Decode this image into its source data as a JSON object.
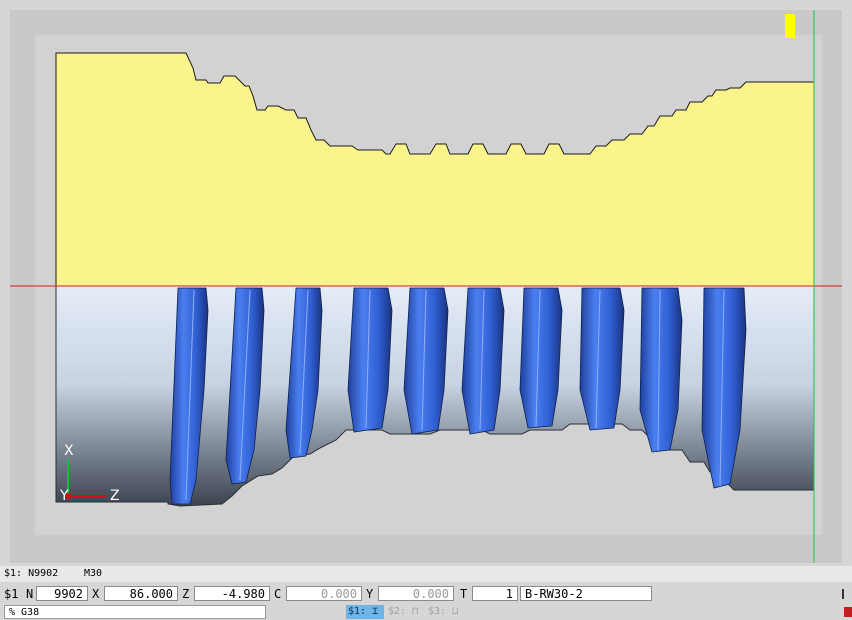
{
  "simulation": {
    "axes": {
      "x_label": "X",
      "y_label": "Y",
      "z_label": "Z"
    },
    "colors": {
      "stock": "#fbf48c",
      "part_top": "#e8eef6",
      "part_bottom": "#3a424e",
      "groove": "#3e6fe0",
      "background": "#c9c9c9",
      "axis_line_red": "#d02020",
      "axis_line_green": "#20c040",
      "tool_marker": "#ffff00"
    }
  },
  "status": {
    "channel_block": "$1: N9902",
    "program_end": "M30"
  },
  "position": {
    "channel": "$1",
    "n_label": "N",
    "n_value": "9902",
    "x_label": "X",
    "x_value": "86.000",
    "z_label": "Z",
    "z_value": "-4.980",
    "c_label": "C",
    "c_value": "0.000",
    "y_label": "Y",
    "y_value": "0.000",
    "t_label": "T",
    "t_value": "1",
    "tool_name": "B-RW30-2"
  },
  "modes": {
    "gcode": "% G38",
    "ch1": "$1:",
    "ch2": "$2:",
    "ch3": "$3:"
  }
}
